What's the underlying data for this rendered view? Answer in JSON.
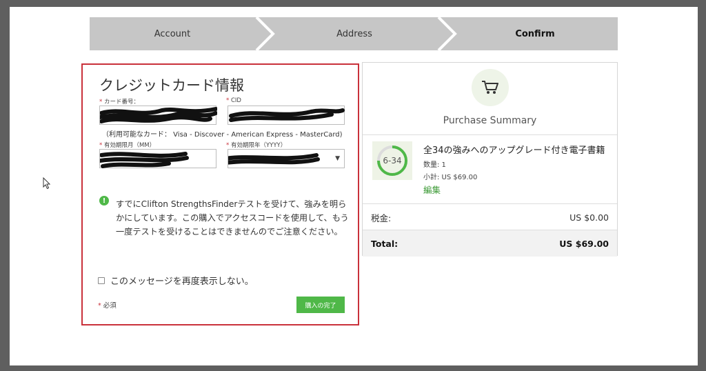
{
  "stepper": {
    "steps": [
      {
        "label": "Account",
        "active": false
      },
      {
        "label": "Address",
        "active": false
      },
      {
        "label": "Confirm",
        "active": true
      }
    ],
    "color": "#c6c6c6"
  },
  "credit_card": {
    "title": "クレジットカード情報",
    "card_number_label": "カード番号：",
    "cid_label": "CID",
    "accepted_cards": "（利用可能なカード： Visa - Discover - American Express - MasterCard)",
    "exp_month_label": "有効期限月（MM）",
    "exp_year_label": "有効期限年（YYYY）",
    "required_mark": "*",
    "info_icon": "!",
    "notice": "すでにClifton StrengthsFinderテストを受けて、強みを明らかにしています。この購入でアクセスコードを使用して、もう一度テストを受けることはできませんのでご注意ください。",
    "dont_show_label": "このメッセージを再度表示しない。",
    "required_note": "必須",
    "submit_label": "購入の完了",
    "select_caret": "▼"
  },
  "summary": {
    "cart_icon": "shopping-cart-icon",
    "title": "Purchase Summary",
    "product": {
      "badge": "6-34",
      "name": "全34の強みへのアップグレード付き電子書籍",
      "qty": "数量: 1",
      "subtotal": "小計: US $69.00",
      "edit": "編集"
    },
    "tax_label": "税金:",
    "tax_value": "US $0.00",
    "total_label": "Total:",
    "total_value": "US $69.00"
  },
  "colors": {
    "accent_green": "#4fb848",
    "highlight_red": "#c9303a",
    "step_gray": "#c6c6c6"
  }
}
